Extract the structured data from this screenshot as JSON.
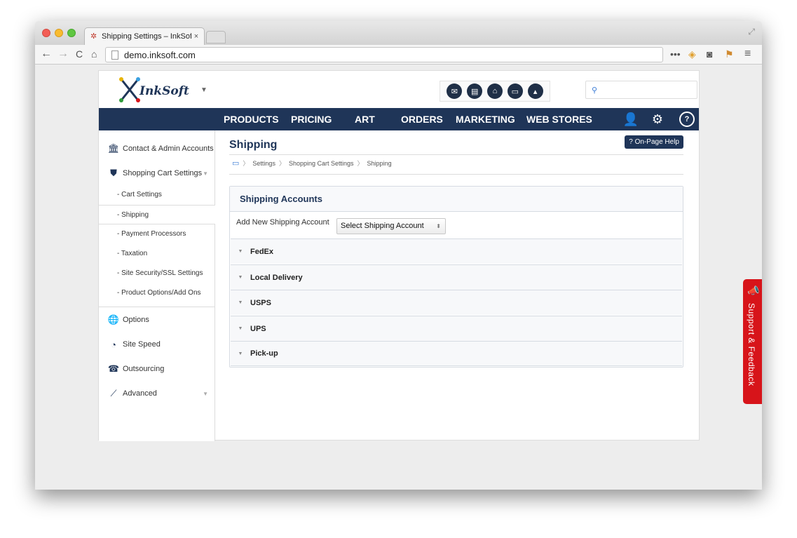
{
  "browser": {
    "tab_title": "Shipping Settings – InkSoft",
    "tab_close": "×",
    "url": "demo.inksoft.com",
    "icons": [
      "back-icon",
      "forward-icon",
      "reload-icon",
      "home-icon",
      "more-icon",
      "extension-icon",
      "pocket-icon",
      "flag-icon",
      "menu-icon"
    ]
  },
  "header": {
    "logo_text": "InkSoft",
    "search_placeholder": "",
    "icons": [
      "mail-icon",
      "clipboard-icon",
      "store-icon",
      "monitor-icon",
      "chart-icon"
    ]
  },
  "nav": {
    "items": [
      "PRODUCTS",
      "PRICING",
      "ART",
      "ORDERS",
      "MARKETING",
      "WEB STORES"
    ],
    "help_glyph": "?"
  },
  "sidebar": {
    "items": [
      {
        "label": "Contact & Admin Accounts",
        "icon": "building-icon"
      },
      {
        "label": "Shopping Cart Settings",
        "icon": "shield-icon"
      }
    ],
    "subitems": [
      "- Cart Settings",
      "- Shipping",
      "- Payment Processors",
      "- Taxation",
      "- Site Security/SSL Settings",
      "- Product Options/Add Ons"
    ],
    "lower_items": [
      {
        "label": "Options",
        "icon": "globe-icon"
      },
      {
        "label": "Site Speed",
        "icon": "speedometer-icon"
      },
      {
        "label": "Outsourcing",
        "icon": "phone-icon"
      },
      {
        "label": "Advanced",
        "icon": "trend-icon"
      }
    ]
  },
  "content": {
    "title": "Shipping",
    "help_button": "? On-Page Help",
    "breadcrumb": [
      "Settings",
      "Shopping Cart Settings",
      "Shipping"
    ],
    "panel_title": "Shipping Accounts",
    "add_label": "Add New Shipping Account",
    "select_value": "Select Shipping Account",
    "accounts": [
      "FedEx",
      "Local Delivery",
      "USPS",
      "UPS",
      "Pick-up"
    ]
  },
  "support": {
    "label": "Support & Feedback"
  },
  "colors": {
    "navy": "#1f3558",
    "support_red": "#d7141a"
  }
}
